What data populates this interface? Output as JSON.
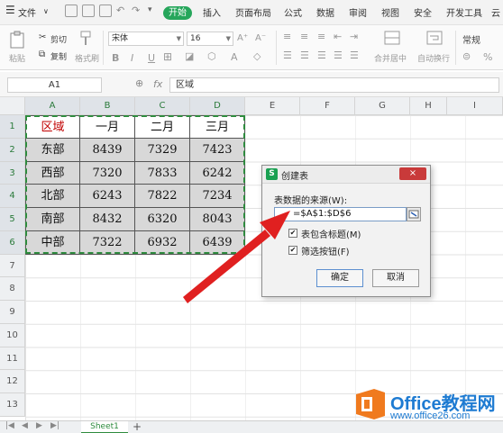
{
  "menu": {
    "file": "文件",
    "start": "开始",
    "tabs": [
      "插入",
      "页面布局",
      "公式",
      "数据",
      "审阅",
      "视图",
      "安全",
      "开发工具",
      "云"
    ]
  },
  "ribbon": {
    "paste": "粘贴",
    "cut": "剪切",
    "copy": "复制",
    "format_painter": "格式刷",
    "font_name": "宋体",
    "font_size": "16",
    "bold": "B",
    "italic": "I",
    "underline": "U",
    "merge_center": "合并居中",
    "wrap_text": "自动换行",
    "number_format": "常规",
    "percent": "%"
  },
  "formula_bar": {
    "name_box": "A1",
    "fx": "fx",
    "value": "区域"
  },
  "columns": [
    "A",
    "B",
    "C",
    "D",
    "E",
    "F",
    "G",
    "H",
    "I"
  ],
  "rows": [
    "1",
    "2",
    "3",
    "4",
    "5",
    "6",
    "7",
    "8",
    "9",
    "10",
    "11",
    "12",
    "13"
  ],
  "table": {
    "header": [
      "区域",
      "一月",
      "二月",
      "三月"
    ],
    "rows": [
      [
        "东部",
        "8439",
        "7329",
        "7423"
      ],
      [
        "西部",
        "7320",
        "7833",
        "6242"
      ],
      [
        "北部",
        "6243",
        "7822",
        "7234"
      ],
      [
        "南部",
        "8432",
        "6320",
        "8043"
      ],
      [
        "中部",
        "7322",
        "6932",
        "6439"
      ]
    ]
  },
  "sheet_tabs": {
    "active": "Sheet1",
    "add": "+"
  },
  "dialog": {
    "title": "创建表",
    "close": "×",
    "source_label": "表数据的来源(W):",
    "source_value": "=$A$1:$D$6",
    "has_headers_label": "表包含标题(M)",
    "has_headers": true,
    "filter_label": "筛选按钮(F)",
    "filter": true,
    "ok": "确定",
    "cancel": "取消"
  },
  "watermark": {
    "title": "Office教程网",
    "url": "www.office26.com"
  },
  "colors": {
    "accent_green": "#26a65b",
    "selection_border": "#2e8b3e",
    "header_red": "#c00000",
    "arrow_red": "#e02020",
    "watermark_blue": "#1e7bd2",
    "watermark_orange": "#f07a1e"
  }
}
